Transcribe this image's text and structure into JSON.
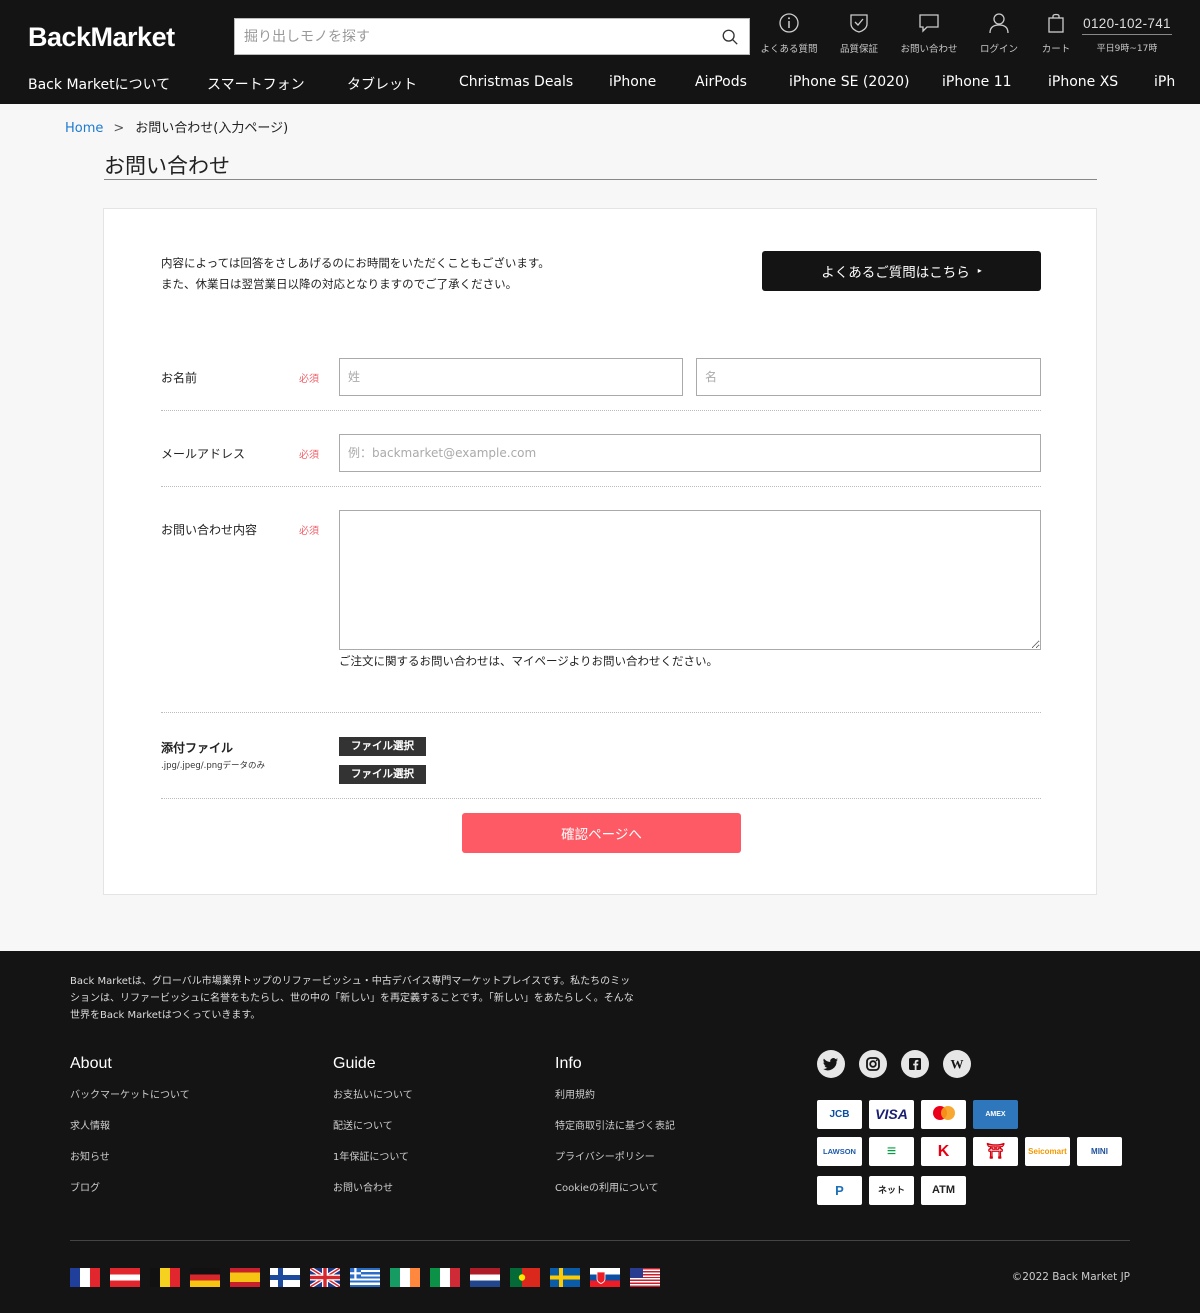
{
  "header": {
    "logo": "BackMarket",
    "search_placeholder": "掘り出しモノを探す",
    "icons": [
      {
        "name": "faq",
        "label": "よくある質問",
        "icon": "info-circle-icon"
      },
      {
        "name": "quality",
        "label": "品質保証",
        "icon": "shield-check-icon"
      },
      {
        "name": "contact",
        "label": "お問い合わせ",
        "icon": "chat-bubble-icon"
      },
      {
        "name": "login",
        "label": "ログイン",
        "icon": "user-icon"
      },
      {
        "name": "cart",
        "label": "カート",
        "icon": "shopping-bag-icon"
      }
    ],
    "phone": "0120-102-741",
    "hours": "平日9時~17時",
    "nav": [
      "Back Marketについて",
      "スマートフォン",
      "タブレット",
      "Christmas Deals",
      "iPhone",
      "AirPods",
      "iPhone SE (2020)",
      "iPhone 11",
      "iPhone XS",
      "iPh"
    ]
  },
  "breadcrumb": {
    "home": "Home",
    "separator": ">",
    "current": "お問い合わせ(入力ページ)"
  },
  "page_title": "お問い合わせ",
  "form": {
    "intro_line1": "内容によっては回答をさしあげるのにお時間をいただくこともございます。",
    "intro_line2": "また、休業日は翌営業日以降の対応となりますのでご了承ください。",
    "faq_button": "よくあるご質問はこちら",
    "faq_arrow": "▸",
    "required": "必須",
    "name_label": "お名前",
    "last_name_placeholder": "姓",
    "first_name_placeholder": "名",
    "email_label": "メールアドレス",
    "email_placeholder": "例：backmarket@example.com",
    "message_label": "お問い合わせ内容",
    "message_note": "ご注文に関するお問い合わせは、マイページよりお問い合わせください。",
    "attach_label": "添付ファイル",
    "attach_sub": ".jpg/.jpeg/.pngデータのみ",
    "file_button": "ファイル選択",
    "submit": "確認ページへ"
  },
  "footer": {
    "description": "Back Marketは、グローバル市場業界トップのリファービッシュ・中古デバイス専門マーケットプレイスです。私たちのミッションは、リファービッシュに名誉をもたらし、世の中の「新しい」を再定義することです。「新しい」をあたらしく。そんな世界をBack Marketはつくっていきます。",
    "columns": [
      {
        "title": "About",
        "links": [
          "バックマーケットについて",
          "求人情報",
          "お知らせ",
          "ブログ"
        ]
      },
      {
        "title": "Guide",
        "links": [
          "お支払いについて",
          "配送について",
          "1年保証について",
          "お問い合わせ"
        ]
      },
      {
        "title": "Info",
        "links": [
          "利用規約",
          "特定商取引法に基づく表記",
          "プライバシーポリシー",
          "Cookieの利用について"
        ]
      }
    ],
    "social": [
      {
        "name": "twitter",
        "glyph": "🐦"
      },
      {
        "name": "instagram",
        "glyph": "◎"
      },
      {
        "name": "facebook",
        "glyph": "f"
      },
      {
        "name": "wikipedia",
        "glyph": "W"
      }
    ],
    "payments": [
      {
        "name": "jcb",
        "label": "JCB",
        "color": "#0b4ea2"
      },
      {
        "name": "visa",
        "label": "VISA",
        "color": "#1a1f71"
      },
      {
        "name": "mastercard",
        "label": "●●",
        "color": "#eb001b"
      },
      {
        "name": "amex",
        "label": "AMEX",
        "color": "#2e77bc"
      },
      {
        "name": "lawson",
        "label": "LAWSON",
        "color": "#1e5aa8"
      },
      {
        "name": "familymart",
        "label": "≡",
        "color": "#00a040"
      },
      {
        "name": "circlek",
        "label": "K",
        "color": "#e60012"
      },
      {
        "name": "ministop-like",
        "label": "⛩",
        "color": "#d7000f"
      },
      {
        "name": "seicomart",
        "label": "Seicomart",
        "color": "#f39800"
      },
      {
        "name": "ministop",
        "label": "MINI",
        "color": "#1d4f9c"
      },
      {
        "name": "payeasy",
        "label": "P",
        "color": "#1e6fb8"
      },
      {
        "name": "netbank",
        "label": "ネット",
        "color": "#222222"
      },
      {
        "name": "atm",
        "label": "ATM",
        "color": "#222222"
      }
    ],
    "copyright": "©2022 Back Market JP"
  },
  "colors": {
    "brand_dark": "#141414",
    "accent": "#fd5a65",
    "link": "#1e7ad0",
    "required": "#f0626b"
  }
}
